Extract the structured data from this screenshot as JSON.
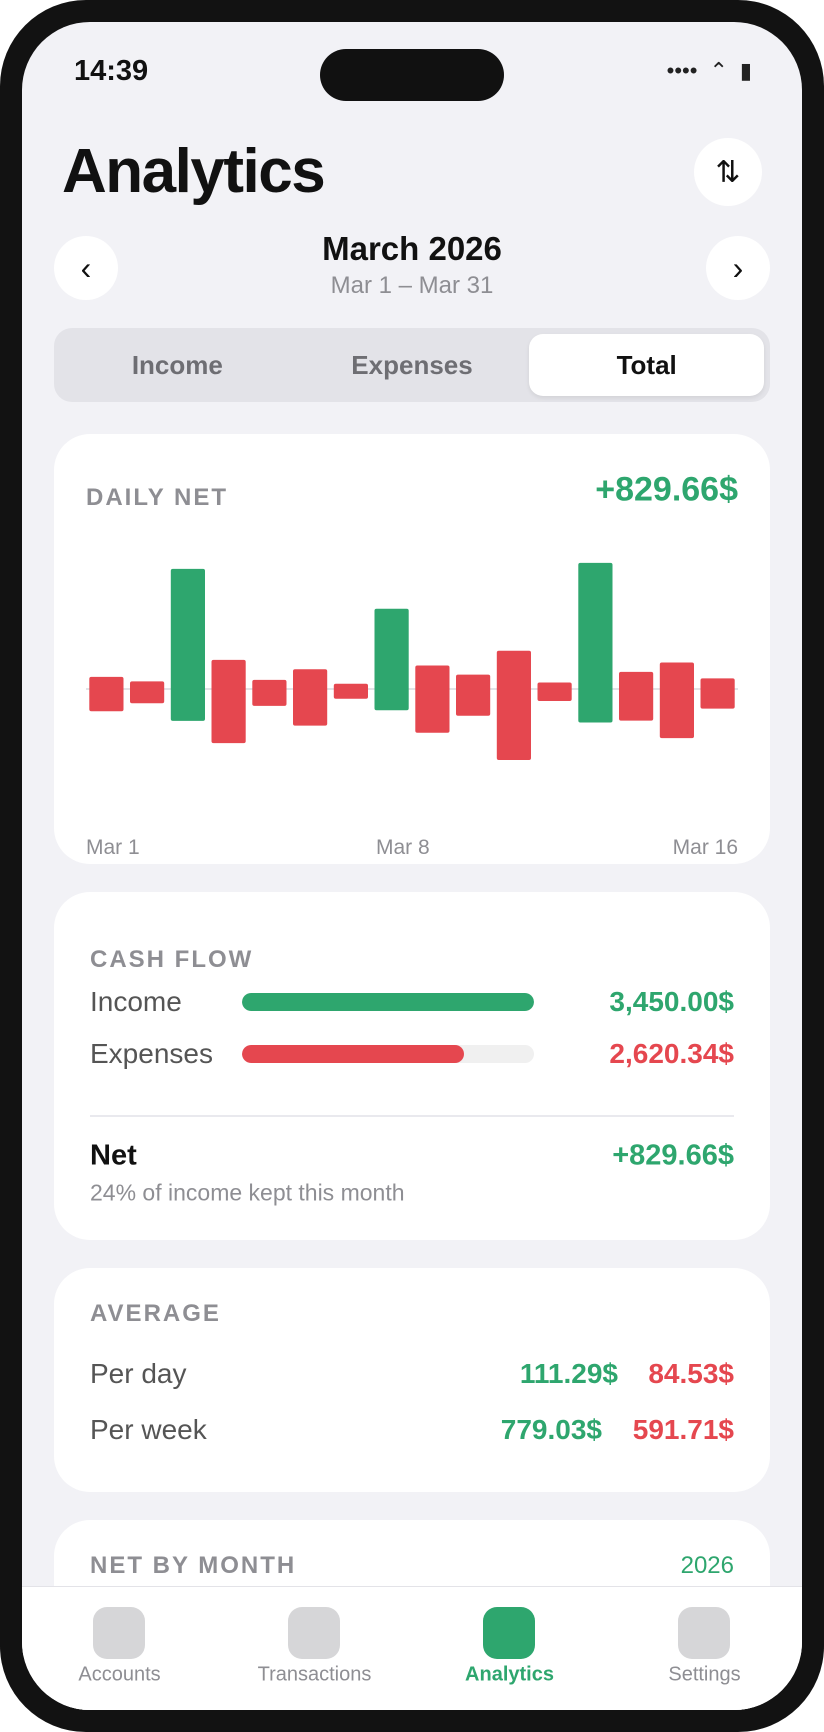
{
  "status_bar": {
    "time": "14:39",
    "signal": "••••",
    "wifi": "⌃",
    "battery": "▮"
  },
  "header": {
    "title": "Analytics",
    "sort_icon": "sort-arrows-icon",
    "sort_glyph": "⇅"
  },
  "period": {
    "title": "March 2026",
    "range": "Mar 1 – Mar 31",
    "prev_glyph": "‹",
    "next_glyph": "›"
  },
  "segments": [
    {
      "label": "Income",
      "active": false
    },
    {
      "label": "Expenses",
      "active": false
    },
    {
      "label": "Total",
      "active": true
    }
  ],
  "daily_net": {
    "label": "DAILY NET",
    "total": "+829.66$",
    "ticks": [
      "Mar 1",
      "Mar 8",
      "Mar 16"
    ]
  },
  "chart_data": {
    "type": "bar",
    "x": [
      1,
      2,
      3,
      4,
      5,
      6,
      7,
      8,
      9,
      10,
      11,
      12,
      13,
      14,
      15,
      16
    ],
    "values": [
      -41,
      -26,
      181,
      -99,
      -31,
      -67,
      -18,
      121,
      -80,
      -49,
      -130,
      -22,
      190,
      -58,
      -90,
      -36
    ],
    "colors": {
      "positive": "#2ea66e",
      "negative": "#e5474f"
    }
  },
  "cash_flow": {
    "label": "CASH FLOW",
    "income": {
      "label": "Income",
      "value": "3,450.00$",
      "fraction": 1.0
    },
    "expenses": {
      "label": "Expenses",
      "value": "2,620.34$",
      "fraction": 0.76
    },
    "net": {
      "label": "Net",
      "value": "+829.66$",
      "note": "24% of income kept this month"
    }
  },
  "average": {
    "label": "AVERAGE",
    "per_day": {
      "label": "Per day",
      "income": "111.29$",
      "expense": "84.53$"
    },
    "per_week": {
      "label": "Per week",
      "income": "779.03$",
      "expense": "591.71$"
    }
  },
  "net_by_month": {
    "label": "NET BY MONTH",
    "year": "2026"
  },
  "tabbar": [
    {
      "label": "Accounts",
      "icon": "accounts-icon",
      "active": false
    },
    {
      "label": "Transactions",
      "icon": "transactions-icon",
      "active": false
    },
    {
      "label": "Analytics",
      "icon": "analytics-icon",
      "active": true
    },
    {
      "label": "Settings",
      "icon": "settings-icon",
      "active": false
    }
  ],
  "colors": {
    "green": "#2ea66e",
    "red": "#e5474f",
    "background": "#f2f2f6"
  }
}
